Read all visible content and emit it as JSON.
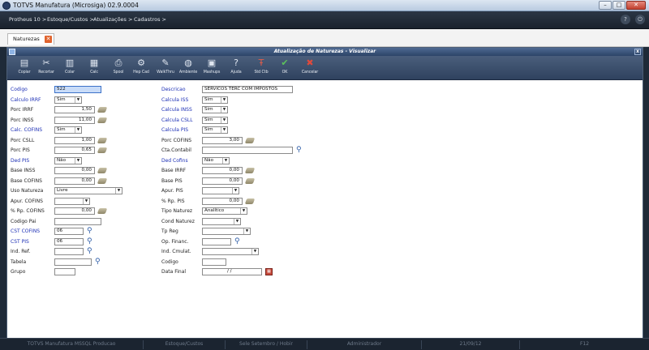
{
  "window": {
    "title": "TOTVS Manufatura (Microsiga) 02.9.0004",
    "min": "–",
    "max": "□",
    "close": "✕"
  },
  "menu": {
    "items": [
      "Protheus 10 >",
      "Estoque/Custos >",
      "Atualizações >",
      "Cadastros >"
    ]
  },
  "tab": {
    "label": "Naturezas",
    "close": "✕"
  },
  "form": {
    "title": "Atualização de Naturezas - Visualizar",
    "close": "x"
  },
  "toolbar": {
    "buttons": [
      {
        "label": "Copiar",
        "icon": "copy-icon",
        "glyph": "▤"
      },
      {
        "label": "Recortar",
        "icon": "scissors-icon",
        "glyph": "✂"
      },
      {
        "label": "Colar",
        "icon": "paste-icon",
        "glyph": "▥"
      },
      {
        "label": "Calc",
        "icon": "calculator-icon",
        "glyph": "▦"
      },
      {
        "label": "Spool",
        "icon": "printer-icon",
        "glyph": "⎙"
      },
      {
        "label": "Hep Cad",
        "icon": "help-register-icon",
        "glyph": "⚙"
      },
      {
        "label": "WalkThru",
        "icon": "walkthru-icon",
        "glyph": "✎"
      },
      {
        "label": "Ambiente",
        "icon": "globe-icon",
        "glyph": "◍"
      },
      {
        "label": "Mashups",
        "icon": "mashups-icon",
        "glyph": "▣"
      },
      {
        "label": "Ajuda",
        "icon": "help-icon",
        "glyph": "?"
      },
      {
        "label": "Std Ctb",
        "icon": "accounting-icon",
        "glyph": "Ŧ"
      },
      {
        "label": "OK",
        "icon": "check-icon",
        "glyph": "✔"
      },
      {
        "label": "Cancelar",
        "icon": "cancel-icon",
        "glyph": "✖"
      }
    ]
  },
  "left": {
    "codigo": {
      "label": "Codigo",
      "value": "522"
    },
    "calculo_irrf": {
      "label": "Calculo IRRF",
      "value": "Sim"
    },
    "porc_irrf": {
      "label": "Porc IRRF",
      "value": "1,50"
    },
    "porc_inss": {
      "label": "Porc INSS",
      "value": "11,00"
    },
    "calc_cofins": {
      "label": "Calc. COFINS",
      "value": "Sim"
    },
    "porc_csll": {
      "label": "Porc CSLL",
      "value": "1,00"
    },
    "porc_pis": {
      "label": "Porc PIS",
      "value": "0,65"
    },
    "ded_pis": {
      "label": "Ded PIS",
      "value": "Não"
    },
    "base_inss": {
      "label": "Base INSS",
      "value": "0,00"
    },
    "base_cofins": {
      "label": "Base COFINS",
      "value": "0,00"
    },
    "uso_natureza": {
      "label": "Uso Natureza",
      "value": "Livre"
    },
    "apur_cofins": {
      "label": "Apur. COFINS",
      "value": ""
    },
    "rp_cofins": {
      "label": "% Rp. COFINS",
      "value": "0,00"
    },
    "codigo_pai": {
      "label": "Codigo Pai",
      "value": ""
    },
    "cst_cofins": {
      "label": "CST COFINS",
      "value": "06"
    },
    "cst_pis": {
      "label": "CST PIS",
      "value": "06"
    },
    "ind_ref": {
      "label": "Ind. Ref.",
      "value": ""
    },
    "tabela": {
      "label": "Tabela",
      "value": ""
    },
    "grupo": {
      "label": "Grupo",
      "value": ""
    }
  },
  "right": {
    "descricao": {
      "label": "Descricao",
      "value": "SERVICOS TERC COM IMPOSTOS"
    },
    "calcula_iss": {
      "label": "Calcula ISS",
      "value": "Sim"
    },
    "calcula_inss": {
      "label": "Calcula INSS",
      "value": "Sim"
    },
    "calcula_csll": {
      "label": "Calcula CSLL",
      "value": "Sim"
    },
    "calcula_pis": {
      "label": "Calcula PIS",
      "value": "Sim"
    },
    "porc_cofins": {
      "label": "Porc COFINS",
      "value": "3,00"
    },
    "cta_contabil": {
      "label": "Cta.Contabil",
      "value": ""
    },
    "ded_cofins": {
      "label": "Ded Cofins",
      "value": "Não"
    },
    "base_irrf": {
      "label": "Base IRRF",
      "value": "0,00"
    },
    "base_pis": {
      "label": "Base PIS",
      "value": "0,00"
    },
    "apur_pis": {
      "label": "Apur. PIS",
      "value": ""
    },
    "rp_pis": {
      "label": "% Rp. PIS",
      "value": "0,00"
    },
    "tipo_naturez": {
      "label": "Tipo Naturez",
      "value": "Analítico"
    },
    "cond_naturez": {
      "label": "Cond Naturez",
      "value": ""
    },
    "tp_reg": {
      "label": "Tp Reg",
      "value": ""
    },
    "op_financ": {
      "label": "Op. Financ.",
      "value": ""
    },
    "ind_cmulat": {
      "label": "Ind. Cmulat.",
      "value": ""
    },
    "codigo": {
      "label": "Codigo",
      "value": ""
    },
    "data_final": {
      "label": "Data Final",
      "value": "/ /"
    }
  },
  "status": {
    "cells": [
      "TOTVS Manufatura MSSQL Producao",
      "Estoque/Custos",
      "Sele Setembro / Hobir",
      "Administrador",
      "21/09/12",
      "F12"
    ]
  }
}
